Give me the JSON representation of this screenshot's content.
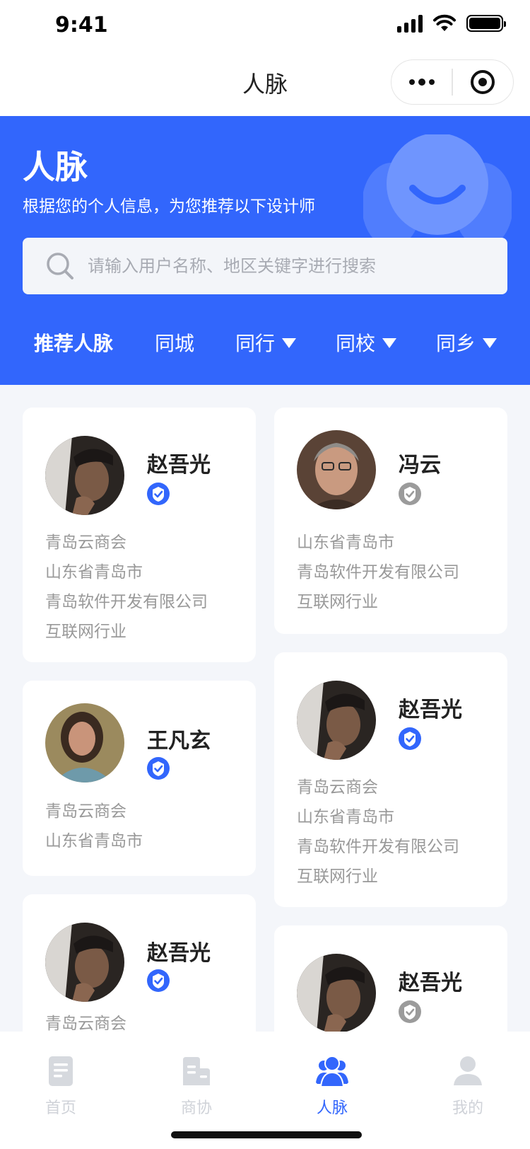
{
  "status_bar": {
    "time": "9:41"
  },
  "nav": {
    "title": "人脉"
  },
  "hero": {
    "title": "人脉",
    "subtitle": "根据您的个人信息，为您推荐以下设计师",
    "search_placeholder": "请输入用户名称、地区关键字进行搜索"
  },
  "tabs": [
    {
      "label": "推荐人脉",
      "active": true,
      "dropdown": false
    },
    {
      "label": "同城",
      "active": false,
      "dropdown": false
    },
    {
      "label": "同行",
      "active": false,
      "dropdown": true
    },
    {
      "label": "同校",
      "active": false,
      "dropdown": true
    },
    {
      "label": "同乡",
      "active": false,
      "dropdown": true
    }
  ],
  "cards": [
    {
      "name": "赵吾光",
      "verified": true,
      "lines": [
        "青岛云商会",
        "山东省青岛市",
        "青岛软件开发有限公司",
        "互联网行业"
      ]
    },
    {
      "name": "冯云",
      "verified": false,
      "lines": [
        "山东省青岛市",
        "青岛软件开发有限公司",
        "互联网行业"
      ]
    },
    {
      "name": "王凡玄",
      "verified": true,
      "lines": [
        "青岛云商会",
        "山东省青岛市"
      ]
    },
    {
      "name": "赵吾光",
      "verified": true,
      "lines": [
        "青岛云商会",
        "山东省青岛市",
        "青岛软件开发有限公司",
        "互联网行业"
      ]
    },
    {
      "name": "赵吾光",
      "verified": true,
      "lines": [
        "青岛云商会"
      ]
    },
    {
      "name": "赵吾光",
      "verified": false,
      "lines": []
    }
  ],
  "tabbar": [
    {
      "label": "首页",
      "icon": "document-icon",
      "active": false
    },
    {
      "label": "商协",
      "icon": "building-icon",
      "active": false
    },
    {
      "label": "人脉",
      "icon": "people-icon",
      "active": true
    },
    {
      "label": "我的",
      "icon": "user-icon",
      "active": false
    }
  ],
  "colors": {
    "primary": "#3266fc",
    "verified": "#3266fc",
    "unverified": "#9b9b9b"
  }
}
